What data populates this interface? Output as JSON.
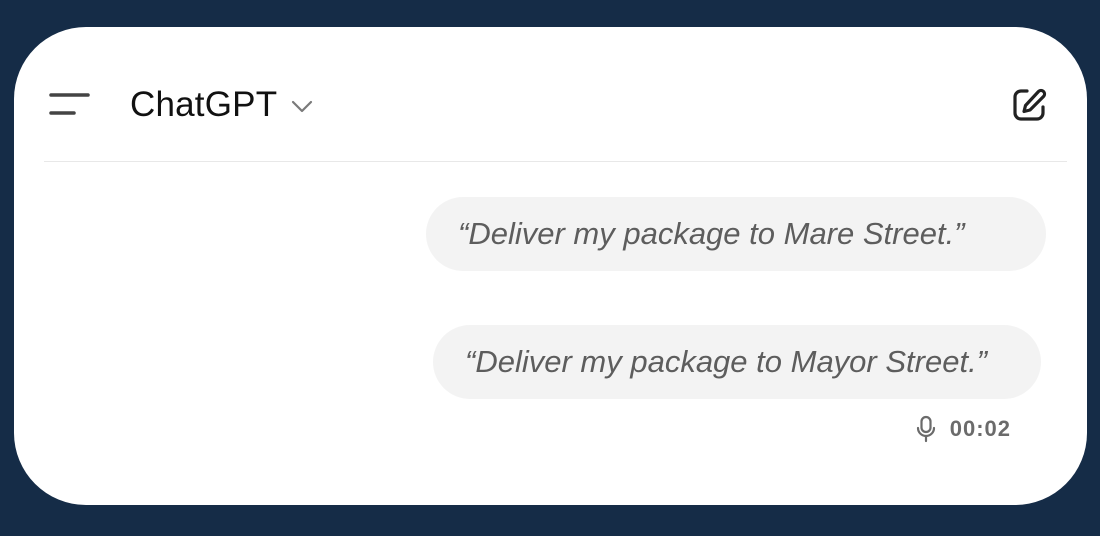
{
  "header": {
    "model_name": "ChatGPT",
    "icons": {
      "menu": "menu-icon",
      "chevron": "chevron-down-icon",
      "new_chat": "new-chat-icon"
    }
  },
  "messages": [
    {
      "role": "user",
      "text": "“Deliver my package to Mare Street.”"
    },
    {
      "role": "user",
      "text": "“Deliver my package to Mayor Street.”"
    }
  ],
  "voice_note": {
    "icon": "microphone-icon",
    "duration": "00:02"
  },
  "colors": {
    "background": "#152c47",
    "card": "#ffffff",
    "bubble": "#f3f3f3",
    "bubble_text": "#5d5d5d"
  }
}
